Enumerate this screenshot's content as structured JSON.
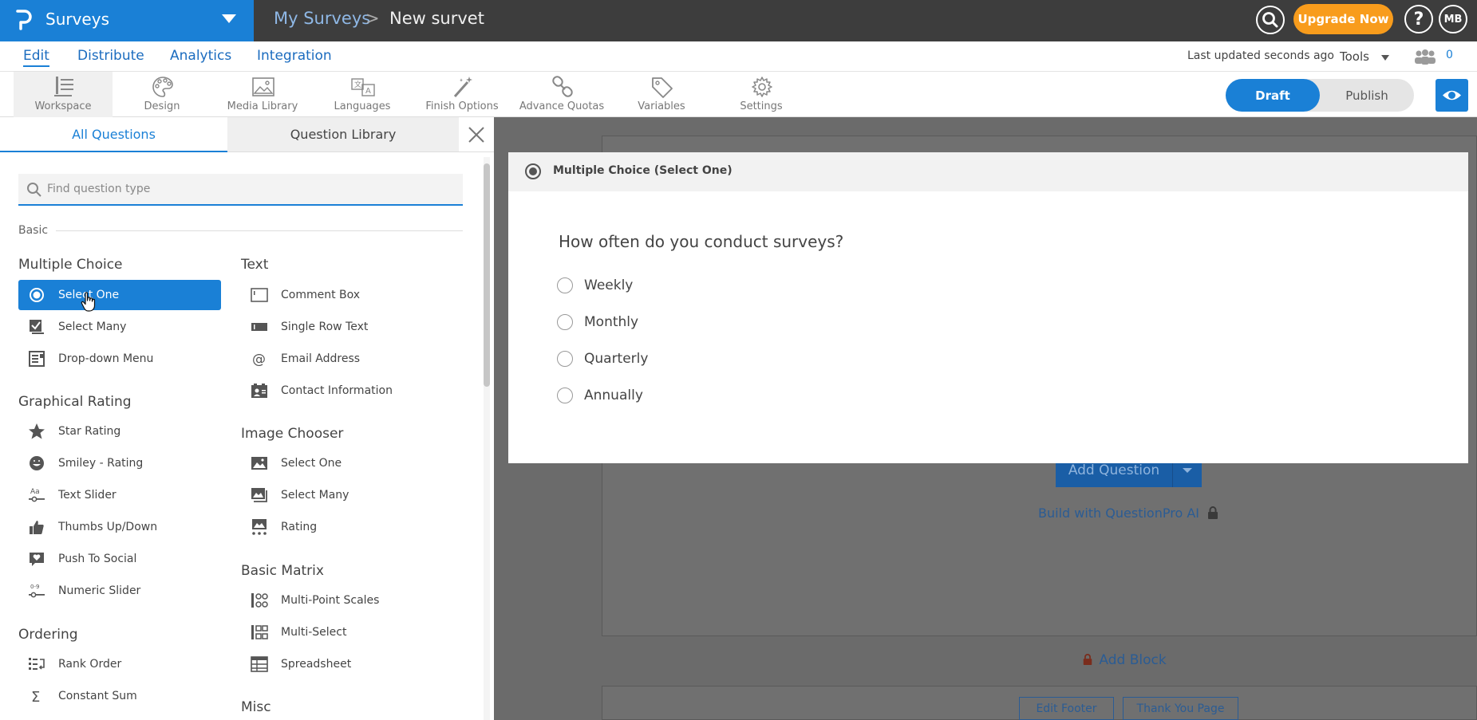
{
  "app": {
    "name": "Surveys",
    "breadcrumb": {
      "root": "My Surveys",
      "separator": ">",
      "current": "New survet"
    },
    "upgrade_label": "Upgrade Now",
    "help_label": "?",
    "avatar_initials": "MB"
  },
  "nav": {
    "items": [
      "Edit",
      "Distribute",
      "Analytics",
      "Integration"
    ],
    "active": "Edit",
    "last_updated": "Last updated seconds ago",
    "tools_label": "Tools",
    "collaborators_count": "0"
  },
  "toolbar": {
    "items": [
      {
        "label": "Workspace",
        "icon": "workspace-icon"
      },
      {
        "label": "Design",
        "icon": "palette-icon"
      },
      {
        "label": "Media Library",
        "icon": "image-icon"
      },
      {
        "label": "Languages",
        "icon": "translate-icon"
      },
      {
        "label": "Finish Options",
        "icon": "magic-wand-icon"
      },
      {
        "label": "Advance Quotas",
        "icon": "chain-icon"
      },
      {
        "label": "Variables",
        "icon": "tag-icon"
      },
      {
        "label": "Settings",
        "icon": "gear-icon"
      }
    ],
    "draft_label": "Draft",
    "publish_label": "Publish"
  },
  "panel": {
    "tabs": [
      "All Questions",
      "Question Library"
    ],
    "search_placeholder": "Find question type",
    "section_label": "Basic",
    "left_column": {
      "multiple_choice": {
        "title": "Multiple Choice",
        "items": [
          "Select One",
          "Select Many",
          "Drop-down Menu"
        ]
      },
      "graphical_rating": {
        "title": "Graphical Rating",
        "items": [
          "Star Rating",
          "Smiley - Rating",
          "Text Slider",
          "Thumbs Up/Down",
          "Push To Social",
          "Numeric Slider"
        ]
      },
      "ordering": {
        "title": "Ordering",
        "items": [
          "Rank Order",
          "Constant Sum"
        ]
      }
    },
    "right_column": {
      "text": {
        "title": "Text",
        "items": [
          "Comment Box",
          "Single Row Text",
          "Email Address",
          "Contact Information"
        ]
      },
      "image_chooser": {
        "title": "Image Chooser",
        "items": [
          "Select One",
          "Select Many",
          "Rating"
        ]
      },
      "basic_matrix": {
        "title": "Basic Matrix",
        "items": [
          "Multi-Point Scales",
          "Multi-Select",
          "Spreadsheet"
        ]
      },
      "misc": {
        "title": "Misc"
      }
    },
    "selected_item": "Select One"
  },
  "canvas": {
    "add_question_label": "Add Question",
    "build_ai_label": "Build with QuestionPro AI",
    "add_block_label": "Add Block",
    "edit_footer_label": "Edit Footer",
    "thank_you_label": "Thank You Page"
  },
  "preview": {
    "type_title": "Multiple Choice (Select One)",
    "question": "How often do you conduct surveys?",
    "options": [
      "Weekly",
      "Monthly",
      "Quarterly",
      "Annually"
    ]
  },
  "colors": {
    "brand_blue": "#1a80d6",
    "topbar_dark": "#3d3d3d",
    "upgrade_orange": "#f89c1c",
    "overlay_gray": "#6b6b6b"
  }
}
